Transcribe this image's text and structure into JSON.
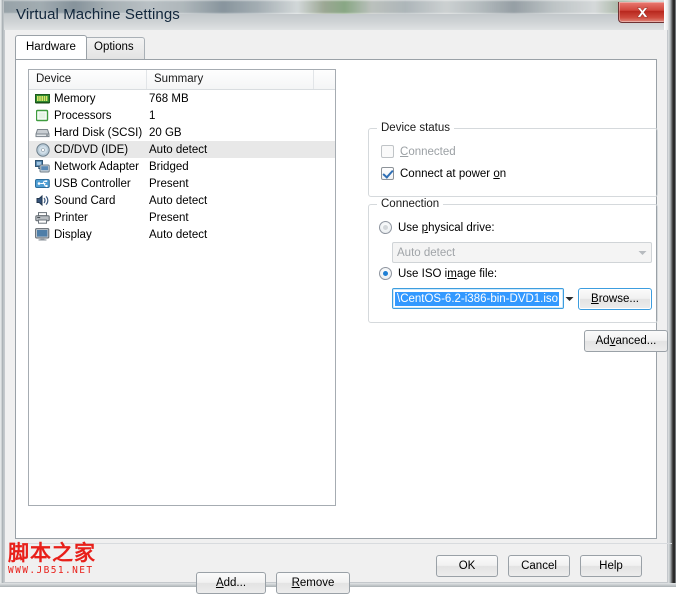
{
  "window": {
    "title": "Virtual Machine Settings",
    "close_label": "x"
  },
  "tabs": [
    {
      "label": "Hardware",
      "active": true
    },
    {
      "label": "Options",
      "active": false
    }
  ],
  "device_list": {
    "columns": [
      "Device",
      "Summary",
      ""
    ],
    "rows": [
      {
        "icon": "memory-icon",
        "device": "Memory",
        "summary": "768 MB",
        "selected": false
      },
      {
        "icon": "processor-icon",
        "device": "Processors",
        "summary": "1",
        "selected": false
      },
      {
        "icon": "hard-disk-icon",
        "device": "Hard Disk (SCSI)",
        "summary": "20 GB",
        "selected": false
      },
      {
        "icon": "cd-dvd-icon",
        "device": "CD/DVD (IDE)",
        "summary": "Auto detect",
        "selected": true
      },
      {
        "icon": "network-adapter-icon",
        "device": "Network Adapter",
        "summary": "Bridged",
        "selected": false
      },
      {
        "icon": "usb-controller-icon",
        "device": "USB Controller",
        "summary": "Present",
        "selected": false
      },
      {
        "icon": "sound-card-icon",
        "device": "Sound Card",
        "summary": "Auto detect",
        "selected": false
      },
      {
        "icon": "printer-icon",
        "device": "Printer",
        "summary": "Present",
        "selected": false
      },
      {
        "icon": "display-icon",
        "device": "Display",
        "summary": "Auto detect",
        "selected": false
      }
    ]
  },
  "list_buttons": {
    "add": "Add...",
    "remove": "Remove"
  },
  "device_status": {
    "legend": "Device status",
    "connected": {
      "label": "Connected",
      "checked": false,
      "disabled": true
    },
    "connect_at_power_on": {
      "label": "Connect at power on",
      "checked": true,
      "disabled": false
    }
  },
  "connection": {
    "legend": "Connection",
    "use_physical_drive": {
      "label": "Use physical drive:",
      "selected": false
    },
    "physical_drive_value": "Auto detect",
    "use_iso_image_file": {
      "label": "Use ISO image file:",
      "selected": true
    },
    "iso_value": "\\CentOS-6.2-i386-bin-DVD1.iso",
    "browse_label": "Browse..."
  },
  "advanced_label": "Advanced...",
  "footer": {
    "ok": "OK",
    "cancel": "Cancel",
    "help": "Help"
  },
  "watermark": {
    "cn": "脚本之家",
    "url": "WWW.JB51.NET",
    "color": "#e8201a"
  },
  "colors": {
    "selection_blue": "#3399ff",
    "focus_blue": "#3c9ddf",
    "row_selected": "#e8e8e8",
    "close_red": "#b8271d"
  }
}
